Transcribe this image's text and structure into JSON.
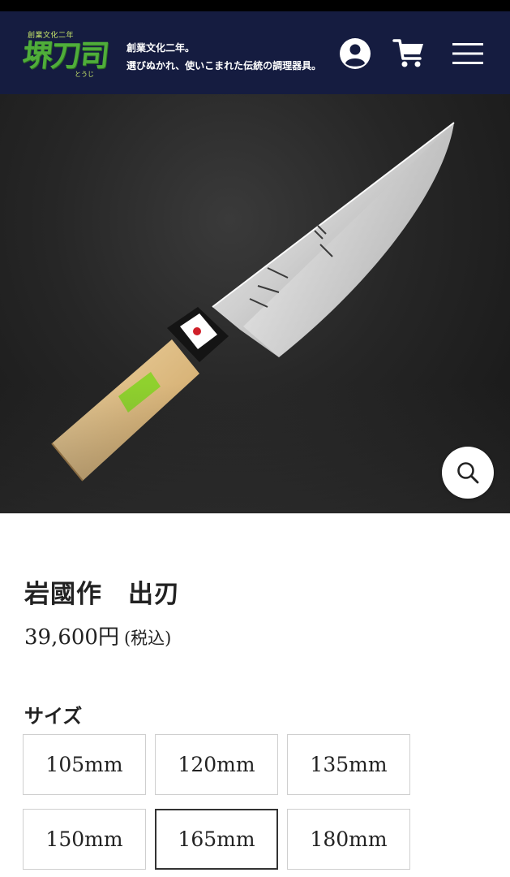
{
  "header": {
    "logo": {
      "top_text": "創業文化二年",
      "main_text": "堺刀司",
      "sub_text": "とうじ"
    },
    "tagline_line1": "創業文化二年。",
    "tagline_line2": "選びぬかれ、使いこまれた伝統の調理器具。",
    "icons": [
      "account-icon",
      "cart-icon",
      "menu-icon"
    ],
    "background_color": "#151c40"
  },
  "hero": {
    "image": "deba knife product photo",
    "zoom_icon": "search-icon"
  },
  "product": {
    "title": "岩國作　出刃",
    "price": "39,600円",
    "tax_note": "(税込)"
  },
  "size": {
    "label": "サイズ",
    "options": [
      "105mm",
      "120mm",
      "135mm",
      "150mm",
      "165mm",
      "180mm"
    ],
    "selected": "165mm"
  }
}
